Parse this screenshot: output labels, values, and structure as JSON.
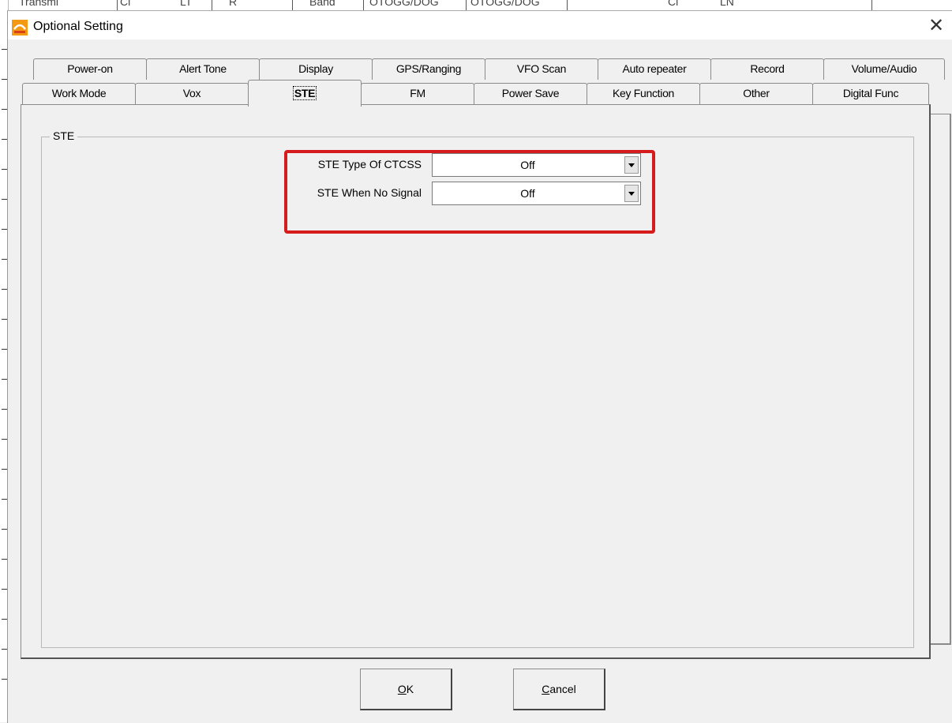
{
  "window": {
    "title": "Optional Setting",
    "close_symbol": "✕",
    "app_icon": "app-logo-icon"
  },
  "background_window": {
    "fragments": [
      "Transmi",
      "Cl",
      "LT",
      "R",
      "Band",
      "OTOGG/DOG",
      "OTOGG/DOG",
      "Cl",
      "LN"
    ]
  },
  "tabs": {
    "row_back": [
      "Power-on",
      "Alert Tone",
      "Display",
      "GPS/Ranging",
      "VFO Scan",
      "Auto repeater",
      "Record",
      "Volume/Audio"
    ],
    "row_front": [
      "Work Mode",
      "Vox",
      "STE",
      "FM",
      "Power Save",
      "Key Function",
      "Other",
      "Digital Func"
    ],
    "active": "STE"
  },
  "ste_group": {
    "title": "STE",
    "fields": [
      {
        "label": "STE Type Of CTCSS",
        "value": "Off"
      },
      {
        "label": "STE When No Signal",
        "value": "Off"
      }
    ]
  },
  "buttons": {
    "ok": {
      "mnemonic": "O",
      "rest": "K"
    },
    "cancel": {
      "mnemonic": "C",
      "rest": "ancel"
    }
  },
  "colors": {
    "highlight": "#d51b1b",
    "dialog_bg": "#f0f0f0"
  }
}
